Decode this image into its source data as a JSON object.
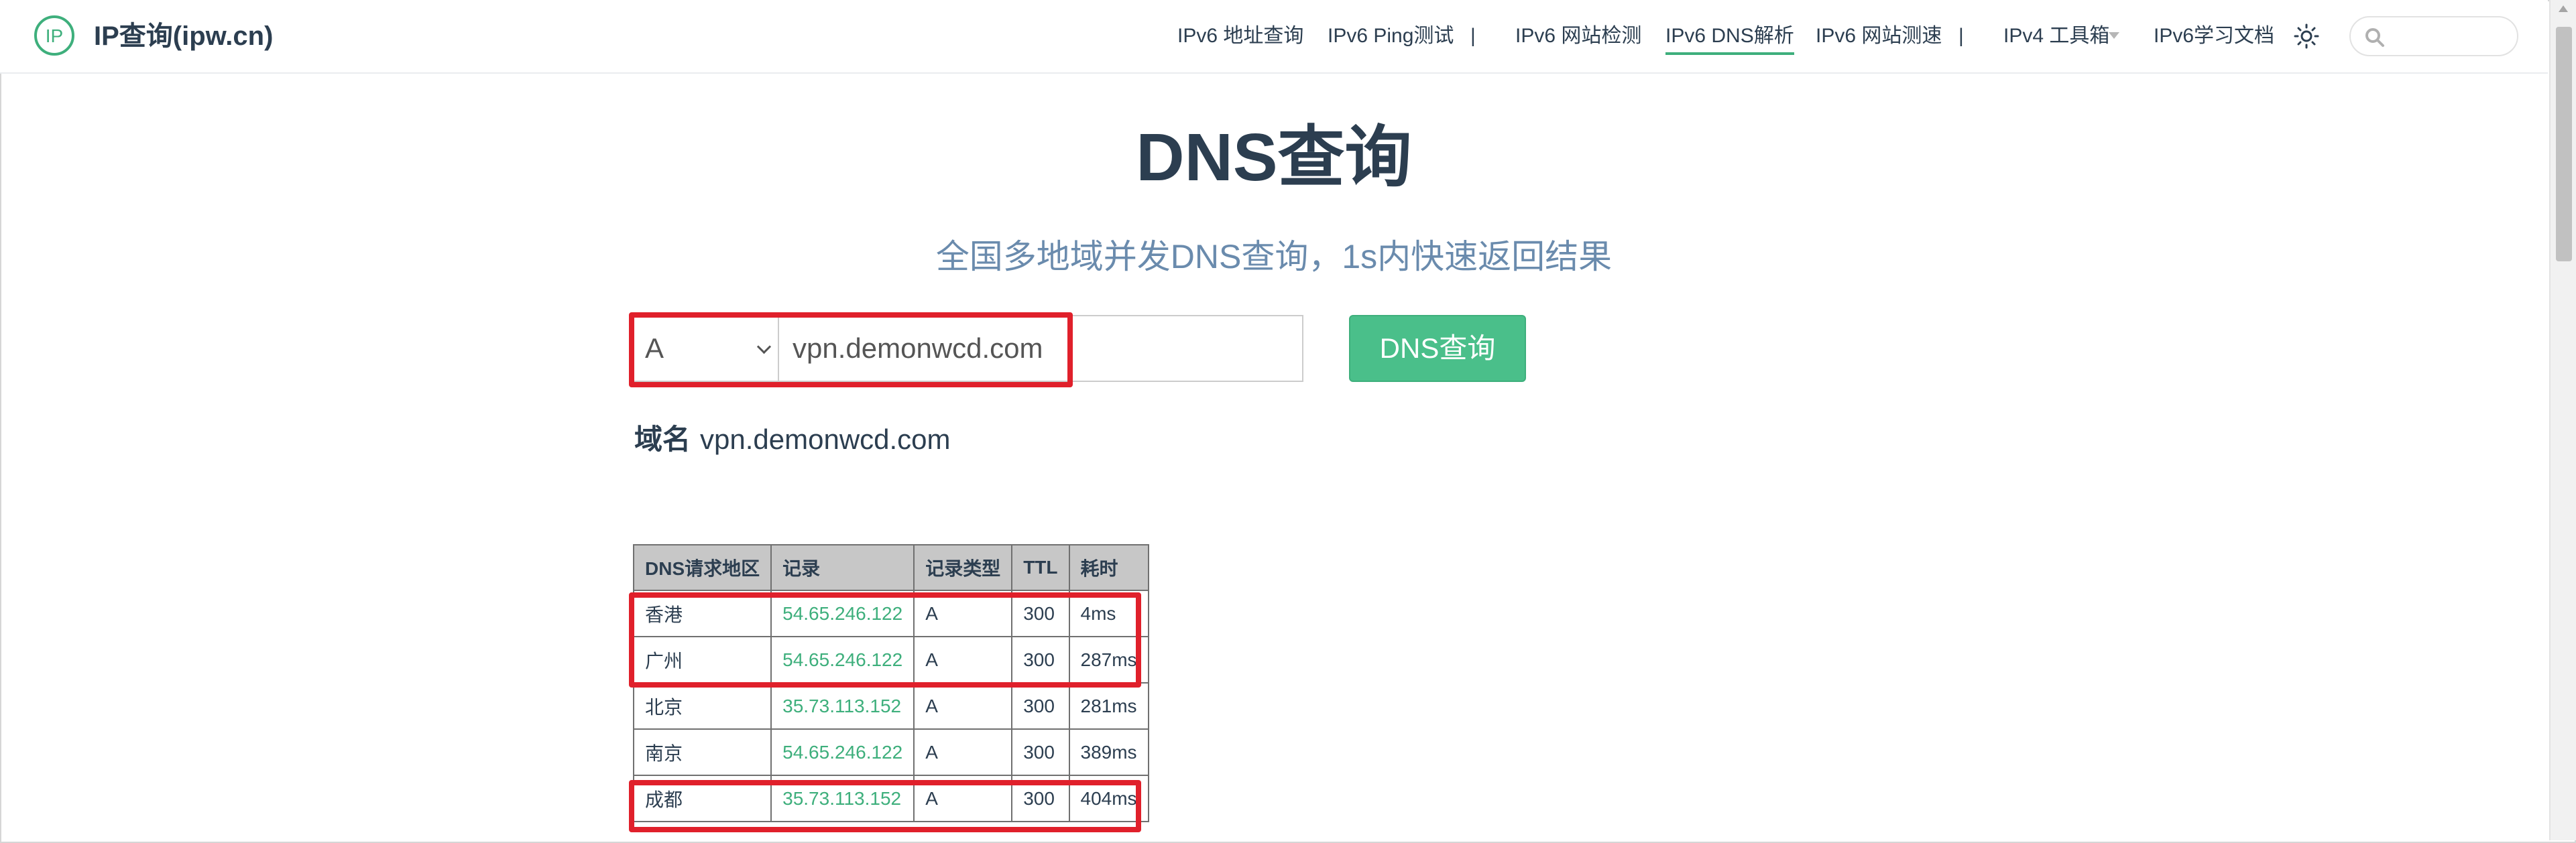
{
  "brand": {
    "title": "IP查询(ipw.cn)",
    "logo_text": "IP",
    "accent_color": "#3eaf7c"
  },
  "nav": {
    "items": [
      {
        "label": "IPv6 地址查询"
      },
      {
        "label": "IPv6 Ping测试"
      },
      {
        "label": "IPv6 网站检测"
      },
      {
        "label": "IPv6 DNS解析",
        "active": true
      },
      {
        "label": "IPv6 网站测速"
      },
      {
        "label": "IPv4 工具箱",
        "dropdown": true
      },
      {
        "label": "IPv6学习文档"
      }
    ],
    "separator": "|",
    "theme_icon": "sun-icon",
    "search_icon": "search-icon",
    "search_placeholder": ""
  },
  "page": {
    "title": "DNS查询",
    "subtitle": "全国多地域并发DNS查询，1s内快速返回结果"
  },
  "form": {
    "record_type": "A",
    "domain_value": "vpn.demonwcd.com",
    "button_label": "DNS查询"
  },
  "result": {
    "domain_label": "域名",
    "domain_value": "vpn.demonwcd.com",
    "columns": [
      "DNS请求地区",
      "记录",
      "记录类型",
      "TTL",
      "耗时"
    ],
    "rows": [
      {
        "region": "香港",
        "record": "54.65.246.122",
        "type": "A",
        "ttl": "300",
        "time": "4ms",
        "highlighted": true
      },
      {
        "region": "广州",
        "record": "54.65.246.122",
        "type": "A",
        "ttl": "300",
        "time": "287ms",
        "highlighted": true
      },
      {
        "region": "北京",
        "record": "35.73.113.152",
        "type": "A",
        "ttl": "300",
        "time": "281ms",
        "highlighted": false
      },
      {
        "region": "南京",
        "record": "54.65.246.122",
        "type": "A",
        "ttl": "300",
        "time": "389ms",
        "highlighted": false
      },
      {
        "region": "成都",
        "record": "35.73.113.152",
        "type": "A",
        "ttl": "300",
        "time": "404ms",
        "highlighted": true
      }
    ]
  },
  "colors": {
    "highlight_box": "#e0202b",
    "button": "#4abf8a",
    "subtitle": "#6a8bad",
    "header_cell": "#c7c7c7"
  }
}
